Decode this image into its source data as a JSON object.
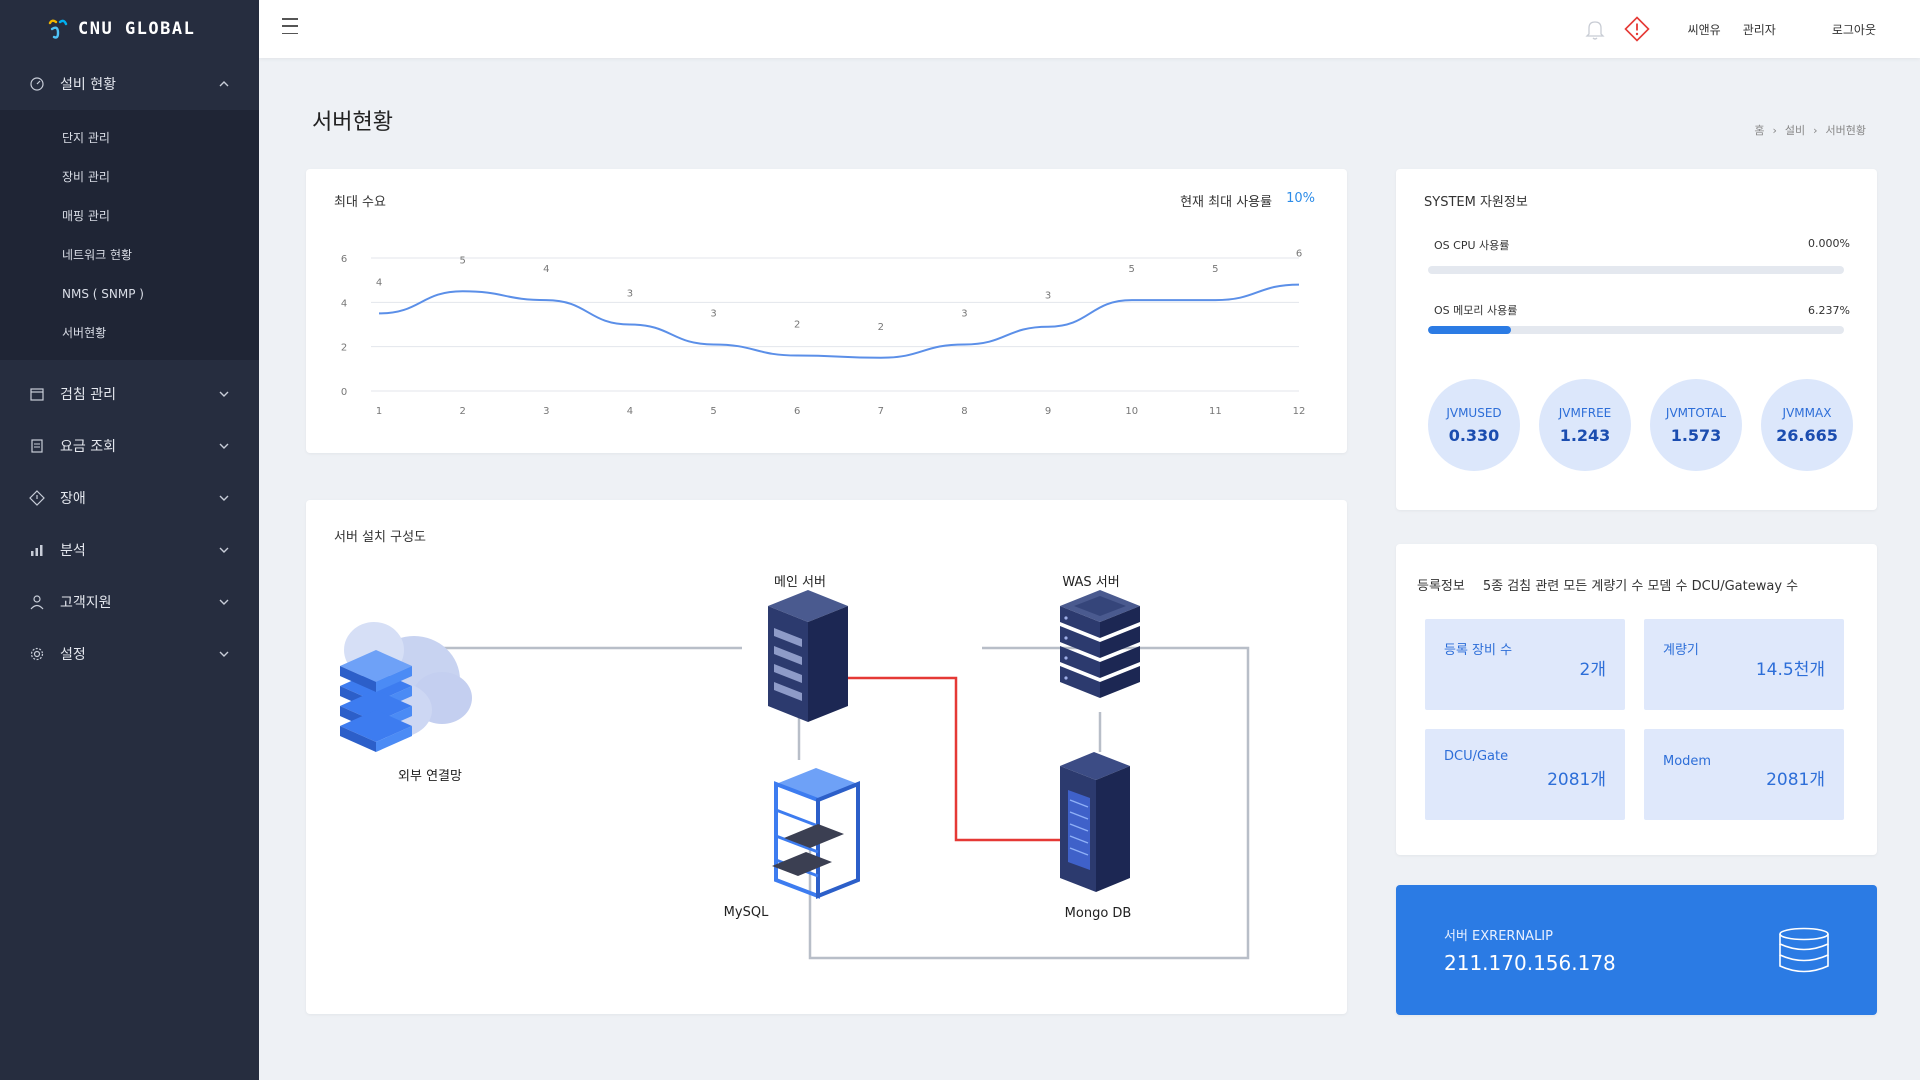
{
  "app": {
    "logo_text": "CNU GLOBAL"
  },
  "sidebar": {
    "groups": [
      {
        "label": "설비 현황",
        "icon": "gauge-icon",
        "expanded": true,
        "items": [
          {
            "label": "단지 관리"
          },
          {
            "label": "장비 관리"
          },
          {
            "label": "매핑 관리"
          },
          {
            "label": "네트워크 현황"
          },
          {
            "label": "NMS ( SNMP )"
          },
          {
            "label": "서버현황"
          }
        ]
      },
      {
        "label": "검침 관리",
        "icon": "calendar-icon",
        "expanded": false
      },
      {
        "label": "요금 조회",
        "icon": "receipt-icon",
        "expanded": false
      },
      {
        "label": "장애",
        "icon": "diamond-alert-icon",
        "expanded": false
      },
      {
        "label": "분석",
        "icon": "bar-chart-icon",
        "expanded": false
      },
      {
        "label": "고객지원",
        "icon": "user-icon",
        "expanded": false
      },
      {
        "label": "설정",
        "icon": "gear-icon",
        "expanded": false
      }
    ]
  },
  "topbar": {
    "user_company": "씨앤유",
    "user_role": "관리자",
    "logout": "로그아웃"
  },
  "page": {
    "title": "서버현황",
    "breadcrumb": [
      "홈",
      "설비",
      "서버현황"
    ]
  },
  "chart_data": {
    "type": "line",
    "title": "최대 수요",
    "current_max_label": "현재 최대 사용률",
    "current_max_value": "10%",
    "x": [
      1,
      2,
      3,
      4,
      5,
      6,
      7,
      8,
      9,
      10,
      11,
      12
    ],
    "values": [
      4,
      5,
      4,
      3,
      3,
      2,
      2,
      3,
      3,
      5,
      5,
      6
    ],
    "line_values": [
      3.5,
      4.5,
      4.1,
      3.0,
      2.1,
      1.6,
      1.5,
      2.1,
      2.9,
      4.1,
      4.1,
      4.8
    ],
    "yticks": [
      0,
      2,
      4,
      6
    ],
    "ylim": [
      0,
      6
    ],
    "grid": true,
    "color": "#5b8fe8"
  },
  "diagram": {
    "title": "서버 설치 구성도",
    "nodes": {
      "external": "외부 연결망",
      "main_server": "메인 서버",
      "was_server": "WAS  서버",
      "mysql": "MySQL",
      "mongodb": "Mongo DB"
    }
  },
  "system": {
    "title": "SYSTEM 자원정보",
    "cpu": {
      "label": "OS CPU 사용률",
      "value": "0.000%",
      "fraction": 0.0
    },
    "memory": {
      "label": "OS 메모리 사용률",
      "value": "6.237%",
      "fraction": 0.2
    },
    "jvm": [
      {
        "label": "JVMUSED",
        "value": "0.330"
      },
      {
        "label": "JVMFREE",
        "value": "1.243"
      },
      {
        "label": "JVMTOTAL",
        "value": "1.573"
      },
      {
        "label": "JVMMAX",
        "value": "26.665"
      }
    ]
  },
  "registration": {
    "title": "등록정보",
    "subtitle": "5종 검침 관련 모든 계량기 수 모뎀 수 DCU/Gateway  수",
    "tiles": [
      {
        "label": "등록 장비 수",
        "value": "2개"
      },
      {
        "label": "계량기",
        "value": "14.5천개"
      },
      {
        "label": "DCU/Gate",
        "value": "2081개"
      },
      {
        "label": "Modem",
        "value": "2081개"
      }
    ]
  },
  "external_ip": {
    "label": "서버 EXRERNALIP",
    "value": "211.170.156.178"
  },
  "colors": {
    "sidebar": "#262d3f",
    "accent": "#2b7be4",
    "tile": "#dfe8fb",
    "alert": "#e53935"
  }
}
